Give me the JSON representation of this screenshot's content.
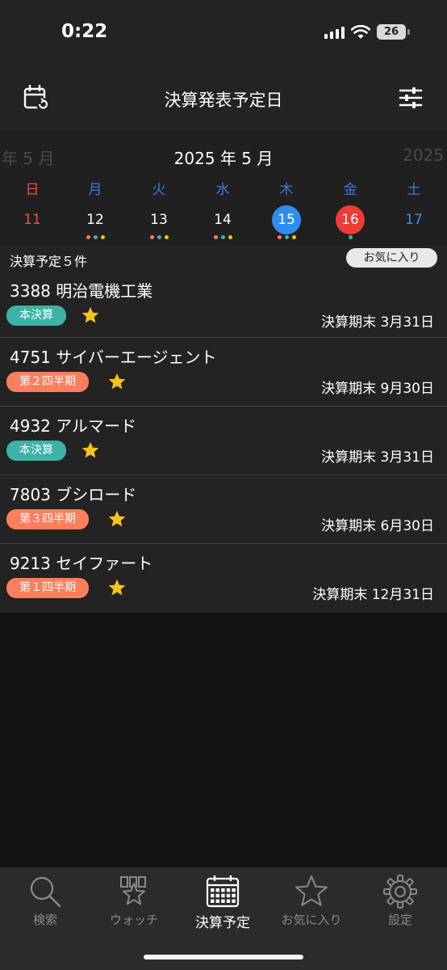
{
  "status_bar": {
    "time": "0:22",
    "battery": "26"
  },
  "nav": {
    "title": "決算発表予定日"
  },
  "calendar": {
    "prev_month": "年 5 月",
    "current_month": "2025 年 5 月",
    "next_month": "2025",
    "weekdays": [
      {
        "label": "日",
        "color": "#ff4a45"
      },
      {
        "label": "月",
        "color": "#3a7ae0"
      },
      {
        "label": "火",
        "color": "#3a7ae0"
      },
      {
        "label": "水",
        "color": "#3a7ae0"
      },
      {
        "label": "木",
        "color": "#3a7ae0"
      },
      {
        "label": "金",
        "color": "#3a7ae0"
      },
      {
        "label": "土",
        "color": "#3a7ae0"
      }
    ],
    "days": [
      {
        "label": "11",
        "color": "#ff4a45",
        "highlight": "",
        "dots": []
      },
      {
        "label": "12",
        "color": "#ffffff",
        "highlight": "",
        "dots": [
          "#ff7a50",
          "#3cb3a8",
          "#f1c40f"
        ]
      },
      {
        "label": "13",
        "color": "#ffffff",
        "highlight": "",
        "dots": [
          "#ff7a50",
          "#3cb3a8",
          "#f1c40f"
        ]
      },
      {
        "label": "14",
        "color": "#ffffff",
        "highlight": "",
        "dots": [
          "#ff7a50",
          "#3cb3a8",
          "#f1c40f"
        ]
      },
      {
        "label": "15",
        "color": "#ffffff",
        "highlight": "#2d8ef0",
        "dots": [
          "#ff7a50",
          "#3cb3a8",
          "#f1c40f"
        ]
      },
      {
        "label": "16",
        "color": "#ffffff",
        "highlight": "#ef3b36",
        "dots": [
          "#3cb3a8"
        ]
      },
      {
        "label": "17",
        "color": "#3a8ef0",
        "highlight": "",
        "dots": []
      }
    ]
  },
  "list": {
    "count_label": "決算予定５件",
    "favorites_filter": "お気に入り",
    "items": [
      {
        "name": "3388 明治電機工業",
        "badge": "本決算",
        "badge_color": "#3cb3a8",
        "period": "決算期末 3月31日",
        "favorite": true
      },
      {
        "name": "4751 サイバーエージェント",
        "badge": "第２四半期",
        "badge_color": "#ff7f5c",
        "period": "決算期末 9月30日",
        "favorite": true
      },
      {
        "name": "4932 アルマード",
        "badge": "本決算",
        "badge_color": "#3cb3a8",
        "period": "決算期末 3月31日",
        "favorite": true
      },
      {
        "name": "7803 ブシロード",
        "badge": "第３四半期",
        "badge_color": "#ff7f5c",
        "period": "決算期末 6月30日",
        "favorite": true
      },
      {
        "name": "9213 セイファート",
        "badge": "第１四半期",
        "badge_color": "#ff7f5c",
        "period": "決算期末 12月31日",
        "favorite": true
      }
    ]
  },
  "tabs": [
    {
      "label": "検索",
      "icon": "search-icon",
      "active": false
    },
    {
      "label": "ウォッチ",
      "icon": "watch-icon",
      "active": false
    },
    {
      "label": "決算予定",
      "icon": "calendar-icon",
      "active": true
    },
    {
      "label": "お気に入り",
      "icon": "star-icon",
      "active": false
    },
    {
      "label": "設定",
      "icon": "gear-icon",
      "active": false
    }
  ],
  "colors": {
    "accent_blue": "#2d8ef0",
    "red": "#ef3b36",
    "star": "#f5c518"
  }
}
